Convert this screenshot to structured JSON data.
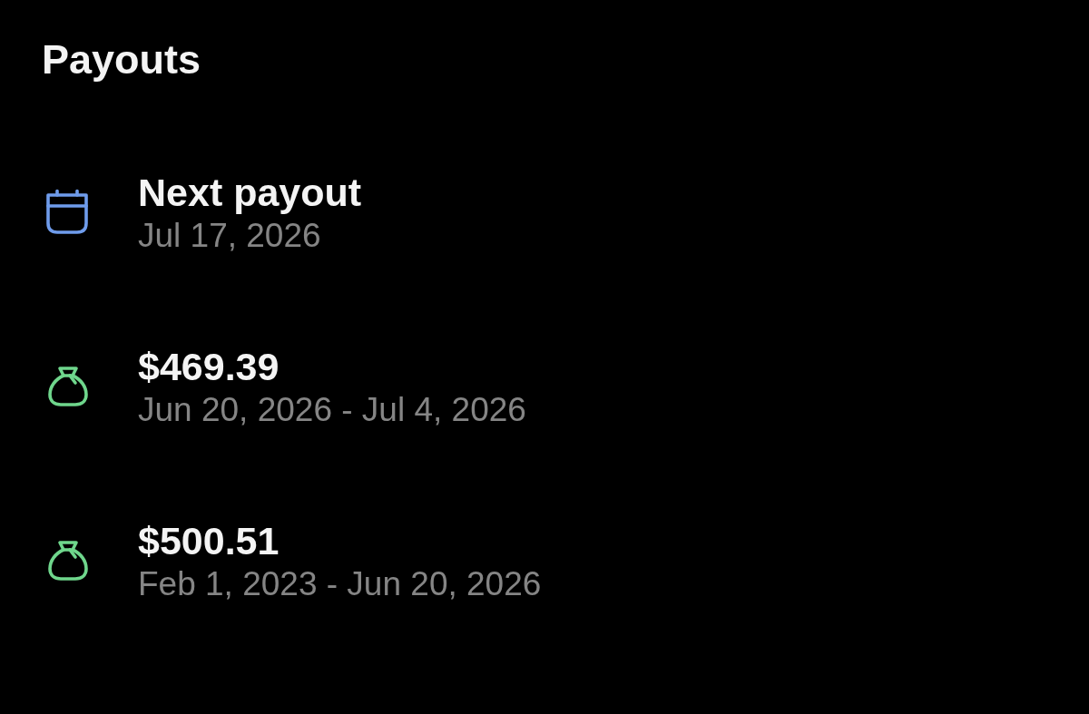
{
  "header": {
    "title": "Payouts"
  },
  "items": [
    {
      "kind": "date",
      "title": "Next payout",
      "subtitle": "Jul 17, 2026"
    },
    {
      "kind": "payout",
      "title": "$469.39",
      "subtitle": "Jun 20, 2026 - Jul 4, 2026"
    },
    {
      "kind": "payout",
      "title": "$500.51",
      "subtitle": "Feb 1, 2023 - Jun 20, 2026"
    }
  ]
}
